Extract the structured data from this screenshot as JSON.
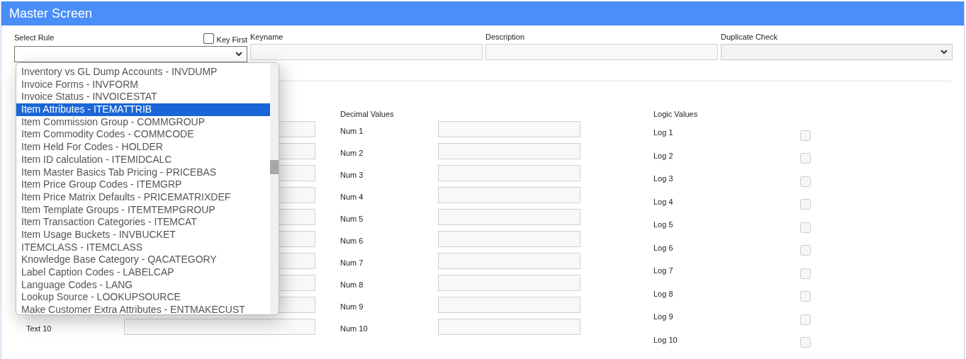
{
  "window": {
    "title": "Master Screen"
  },
  "header_fields": {
    "select_rule": {
      "label": "Select Rule"
    },
    "key_first": {
      "label": "Key First",
      "checked": false
    },
    "keyname": {
      "label": "Keyname"
    },
    "description": {
      "label": "Description"
    },
    "duplicate_check": {
      "label": "Duplicate Check",
      "disabled": true
    }
  },
  "rule_dropdown": {
    "open": true,
    "items": [
      {
        "label": "Inventory vs GL Dump Accounts - INVDUMP",
        "selected": false
      },
      {
        "label": "Invoice Forms - INVFORM",
        "selected": false
      },
      {
        "label": "Invoice Status - INVOICESTAT",
        "selected": false
      },
      {
        "label": "Item Attributes - ITEMATTRIB",
        "selected": true
      },
      {
        "label": "Item Commission Group - COMMGROUP",
        "selected": false
      },
      {
        "label": "Item Commodity Codes - COMMCODE",
        "selected": false
      },
      {
        "label": "Item Held For Codes - HOLDER",
        "selected": false
      },
      {
        "label": "Item ID calculation - ITEMIDCALC",
        "selected": false
      },
      {
        "label": "Item Master Basics Tab Pricing - PRICEBAS",
        "selected": false
      },
      {
        "label": "Item Price Group Codes - ITEMGRP",
        "selected": false
      },
      {
        "label": "Item Price Matrix Defaults - PRICEMATRIXDEF",
        "selected": false
      },
      {
        "label": "Item Template Groups - ITEMTEMPGROUP",
        "selected": false
      },
      {
        "label": "Item Transaction Categories - ITEMCAT",
        "selected": false
      },
      {
        "label": "Item Usage Buckets - INVBUCKET",
        "selected": false
      },
      {
        "label": "ITEMCLASS - ITEMCLASS",
        "selected": false
      },
      {
        "label": "Knowledge Base Category - QACATEGORY",
        "selected": false
      },
      {
        "label": "Label Caption Codes - LABELCAP",
        "selected": false
      },
      {
        "label": "Language Codes - LANG",
        "selected": false
      },
      {
        "label": "Lookup Source - LOOKUPSOURCE",
        "selected": false
      },
      {
        "label": "Make Customer Extra Attributes - ENTMAKECUST",
        "selected": false
      }
    ]
  },
  "text_values": {
    "rows": [
      {
        "kind": "covered"
      },
      {
        "kind": "covered"
      },
      {
        "kind": "covered"
      },
      {
        "kind": "covered"
      },
      {
        "kind": "covered"
      },
      {
        "kind": "covered"
      },
      {
        "kind": "covered"
      },
      {
        "kind": "covered"
      },
      {
        "kind": "covered"
      },
      {
        "kind": "labeled",
        "label": "Text 10"
      }
    ]
  },
  "decimal_values": {
    "heading": "Decimal Values",
    "rows": [
      {
        "label": "Num 1"
      },
      {
        "label": "Num 2"
      },
      {
        "label": "Num 3"
      },
      {
        "label": "Num 4"
      },
      {
        "label": "Num 5"
      },
      {
        "label": "Num 6"
      },
      {
        "label": "Num 7"
      },
      {
        "label": "Num 8"
      },
      {
        "label": "Num 9"
      },
      {
        "label": "Num 10"
      }
    ]
  },
  "logic_values": {
    "heading": "Logic Values",
    "rows": [
      {
        "label": "Log 1",
        "checked": false
      },
      {
        "label": "Log 2",
        "checked": false
      },
      {
        "label": "Log 3",
        "checked": false
      },
      {
        "label": "Log 4",
        "checked": false
      },
      {
        "label": "Log 5",
        "checked": false
      },
      {
        "label": "Log 6",
        "checked": false
      },
      {
        "label": "Log 7",
        "checked": false
      },
      {
        "label": "Log 8",
        "checked": false
      },
      {
        "label": "Log 9",
        "checked": false
      },
      {
        "label": "Log 10",
        "checked": false
      }
    ]
  }
}
